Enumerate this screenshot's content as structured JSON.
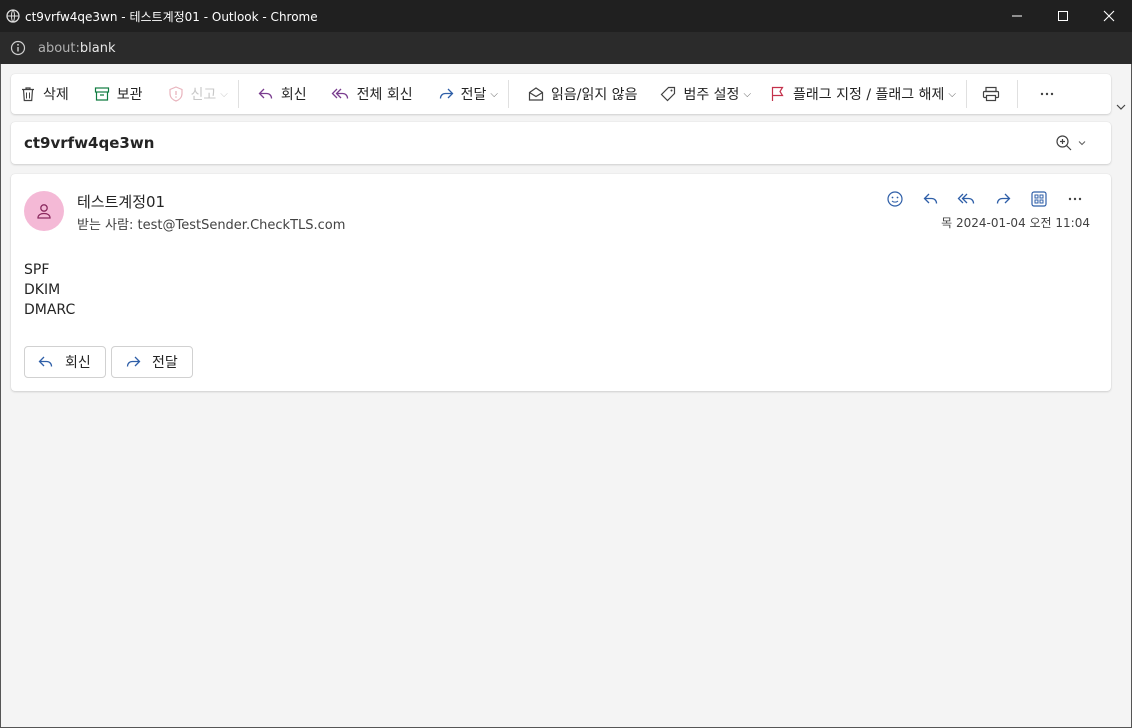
{
  "window": {
    "title": "ct9vrfw4qe3wn - 테스트계정01 - Outlook - Chrome"
  },
  "address": {
    "scheme": "about:",
    "path": "blank"
  },
  "toolbar": {
    "delete": "삭제",
    "archive": "보관",
    "report": "신고",
    "reply": "회신",
    "reply_all": "전체 회신",
    "forward": "전달",
    "read_unread": "읽음/읽지 않음",
    "categorize": "범주 설정",
    "flag": "플래그 지정 / 플래그 해제"
  },
  "message": {
    "subject": "ct9vrfw4qe3wn",
    "sender": "테스트계정01",
    "to_label": "받는 사람:",
    "to_address": "test@TestSender.CheckTLS.com",
    "datetime": "목 2024-01-04 오전 11:04",
    "body_lines": [
      "SPF",
      "DKIM",
      "DMARC"
    ],
    "reply_label": "회신",
    "forward_label": "전달"
  },
  "colors": {
    "accent": "#2f5fa8",
    "avatar_bg": "#f4b9d6",
    "flag": "#c4314b",
    "archive": "#107c41"
  }
}
